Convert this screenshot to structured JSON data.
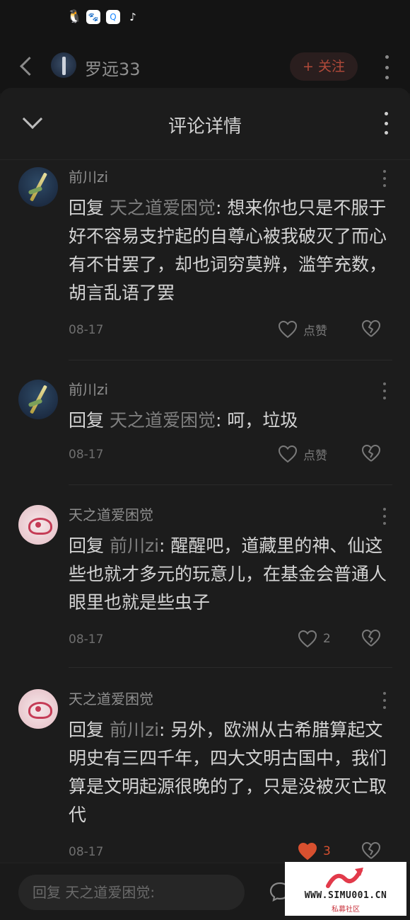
{
  "status_bar": {
    "icons": [
      "qq-icon",
      "baidu-icon",
      "q-browser-icon",
      "tiktok-icon"
    ]
  },
  "profile_header": {
    "username": "罗远33",
    "follow_label": "+ 关注"
  },
  "sheet": {
    "title": "评论详情"
  },
  "comments": [
    {
      "author": "前川zi",
      "reply_label": "回复",
      "reply_to": "天之道爱困觉",
      "text": ": 想来你也只是不服于好不容易支拧起的自尊心被我破灭了而心有不甘罢了，却也词穷莫辨，滥竽充数，胡言乱语了罢",
      "date": "08-17",
      "like_label": "点赞",
      "liked": false
    },
    {
      "author": "前川zi",
      "reply_label": "回复",
      "reply_to": "天之道爱困觉",
      "text": ": 呵，垃圾",
      "date": "08-17",
      "like_label": "点赞",
      "liked": false
    },
    {
      "author": "天之道爱困觉",
      "reply_label": "回复",
      "reply_to": "前川zi",
      "text": ": 醒醒吧，道藏里的神、仙这些也就才多元的玩意儿，在基金会普通人眼里也就是些虫子",
      "date": "08-17",
      "like_label": "2",
      "liked": false
    },
    {
      "author": "天之道爱困觉",
      "reply_label": "回复",
      "reply_to": "前川zi",
      "text": ": 另外，欧洲从古希腊算起文明史有三四千年，四大文明古国中，我们算是文明起源很晚的了，只是没被灭亡取代",
      "date": "08-17",
      "like_label": "3",
      "liked": true
    }
  ],
  "bottom_bar": {
    "reply_placeholder": "回复 天之道爱困觉:"
  },
  "watermark": {
    "url": "WWW.SIMU001.CN",
    "sub": "私募社区"
  },
  "colors": {
    "background": "#1c1c1c",
    "accent_like": "#d8502f",
    "follow_text": "#b24a3a"
  }
}
